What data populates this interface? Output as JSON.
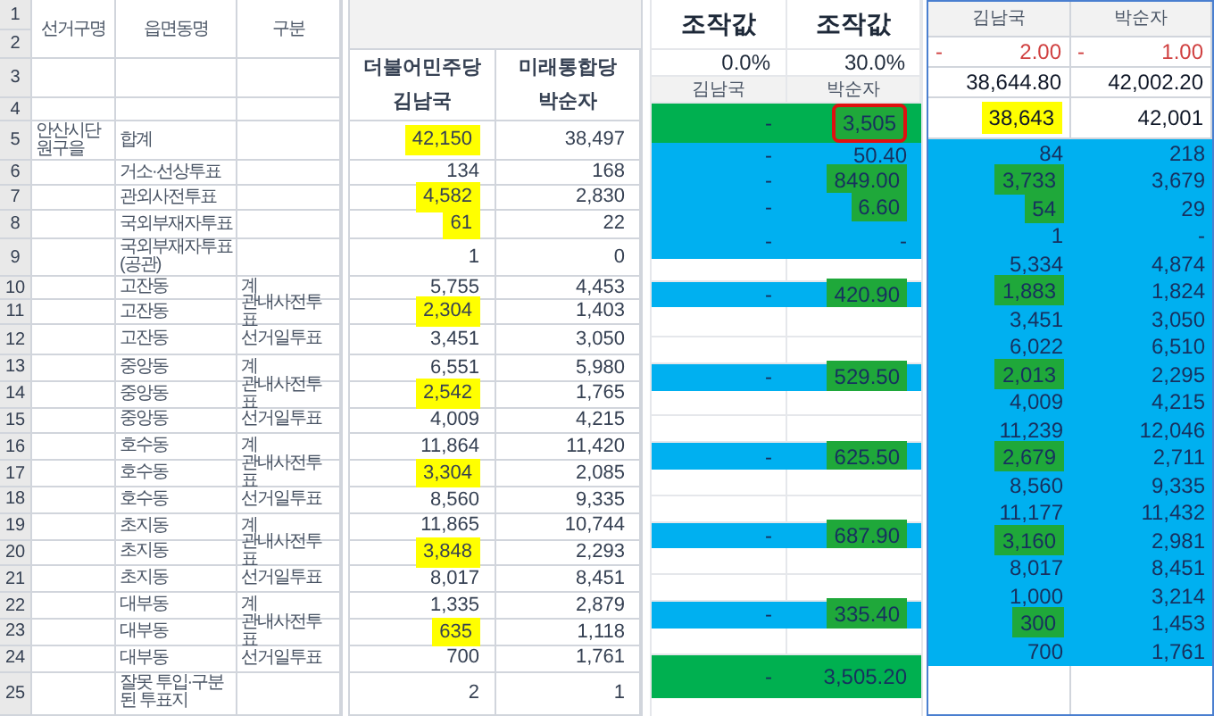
{
  "sheet_a": {
    "row_numbers": [
      "1",
      "2",
      "3",
      "4",
      "5",
      "6",
      "7",
      "8",
      "9",
      "10",
      "11",
      "12",
      "13",
      "14",
      "15",
      "16",
      "17",
      "18",
      "19",
      "20",
      "21",
      "22",
      "23",
      "24",
      "25"
    ],
    "columns": [
      "선거구명",
      "읍면동명",
      "구분"
    ],
    "rows": [
      {
        "district": "안산시단원구을",
        "dong": "합계"
      },
      {
        "dong": "거소·선상투표"
      },
      {
        "dong": "관외사전투표"
      },
      {
        "dong": "국외부재자투표"
      },
      {
        "dong": "국외부재자투표(공관)"
      },
      {
        "dong": "고잔동",
        "type": "계"
      },
      {
        "dong": "고잔동",
        "type": "관내사전투표"
      },
      {
        "dong": "고잔동",
        "type": "선거일투표"
      },
      {
        "dong": "중앙동",
        "type": "계"
      },
      {
        "dong": "중앙동",
        "type": "관내사전투표"
      },
      {
        "dong": "중앙동",
        "type": "선거일투표"
      },
      {
        "dong": "호수동",
        "type": "계"
      },
      {
        "dong": "호수동",
        "type": "관내사전투표"
      },
      {
        "dong": "호수동",
        "type": "선거일투표"
      },
      {
        "dong": "초지동",
        "type": "계"
      },
      {
        "dong": "초지동",
        "type": "관내사전투표"
      },
      {
        "dong": "초지동",
        "type": "선거일투표"
      },
      {
        "dong": "대부동",
        "type": "계"
      },
      {
        "dong": "대부동",
        "type": "관내사전투표"
      },
      {
        "dong": "대부동",
        "type": "선거일투표"
      },
      {
        "dong": "잘못 투입·구분된 투표지"
      }
    ]
  },
  "sheet_b": {
    "columns": [
      {
        "party": "더불어민주당",
        "candidate": "김남국"
      },
      {
        "party": "미래통합당",
        "candidate": "박순자"
      }
    ],
    "rows": [
      [
        {
          "text": "42,150",
          "highlighted": true,
          "color": "#ffff00"
        },
        {
          "text": "38,497",
          "highlighted": false
        }
      ],
      [
        {
          "text": "134",
          "highlighted": false
        },
        {
          "text": "168",
          "highlighted": false
        }
      ],
      [
        {
          "text": "4,582",
          "highlighted": true,
          "color": "#ffff00"
        },
        {
          "text": "2,830",
          "highlighted": false
        }
      ],
      [
        {
          "text": "61",
          "highlighted": true,
          "color": "#ffff00"
        },
        {
          "text": "22",
          "highlighted": false
        }
      ],
      [
        {
          "text": "1",
          "highlighted": false
        },
        {
          "text": "0",
          "highlighted": false
        }
      ],
      [
        {
          "text": "5,755",
          "highlighted": false
        },
        {
          "text": "4,453",
          "highlighted": false
        }
      ],
      [
        {
          "text": "2,304",
          "highlighted": true,
          "color": "#ffff00"
        },
        {
          "text": "1,403",
          "highlighted": false
        }
      ],
      [
        {
          "text": "3,451",
          "highlighted": false
        },
        {
          "text": "3,050",
          "highlighted": false
        }
      ],
      [
        {
          "text": "6,551",
          "highlighted": false
        },
        {
          "text": "5,980",
          "highlighted": false
        }
      ],
      [
        {
          "text": "2,542",
          "highlighted": true,
          "color": "#ffff00"
        },
        {
          "text": "1,765",
          "highlighted": false
        }
      ],
      [
        {
          "text": "4,009",
          "highlighted": false
        },
        {
          "text": "4,215",
          "highlighted": false
        }
      ],
      [
        {
          "text": "11,864",
          "highlighted": false
        },
        {
          "text": "11,420",
          "highlighted": false
        }
      ],
      [
        {
          "text": "3,304",
          "highlighted": true,
          "color": "#ffff00"
        },
        {
          "text": "2,085",
          "highlighted": false
        }
      ],
      [
        {
          "text": "8,560",
          "highlighted": false
        },
        {
          "text": "9,335",
          "highlighted": false
        }
      ],
      [
        {
          "text": "11,865",
          "highlighted": false
        },
        {
          "text": "10,744",
          "highlighted": false
        }
      ],
      [
        {
          "text": "3,848",
          "highlighted": true,
          "color": "#ffff00"
        },
        {
          "text": "2,293",
          "highlighted": false
        }
      ],
      [
        {
          "text": "8,017",
          "highlighted": false
        },
        {
          "text": "8,451",
          "highlighted": false
        }
      ],
      [
        {
          "text": "1,335",
          "highlighted": false
        },
        {
          "text": "2,879",
          "highlighted": false
        }
      ],
      [
        {
          "text": "635",
          "highlighted": true,
          "color": "#ffff00"
        },
        {
          "text": "1,118",
          "highlighted": false
        }
      ],
      [
        {
          "text": "700",
          "highlighted": false
        },
        {
          "text": "1,761",
          "highlighted": false
        }
      ],
      [
        {
          "text": "2",
          "highlighted": false
        },
        {
          "text": "1",
          "highlighted": false
        }
      ]
    ]
  },
  "sheet_c": {
    "headers": [
      "조작값",
      "조작값"
    ],
    "rates": [
      "0.0%",
      "30.0%"
    ],
    "candidates": [
      "김남국",
      "박순자"
    ],
    "rows": [
      {
        "color": "#00b050",
        "cells": [
          {
            "text": "-",
            "highlighted": false,
            "circled": false
          },
          {
            "text": "3,505",
            "highlighted": true,
            "color": "#1fa83a",
            "circled": true
          }
        ]
      },
      {
        "color": "#00b0f0",
        "cells": [
          {
            "text": "-",
            "highlighted": false,
            "circled": false
          },
          {
            "text": "50.40",
            "highlighted": false,
            "circled": false
          }
        ]
      },
      {
        "color": "#00b0f0",
        "cells": [
          {
            "text": "-",
            "highlighted": false,
            "circled": false
          },
          {
            "text": "849.00",
            "highlighted": true,
            "color": "#1fa83a",
            "circled": false
          }
        ]
      },
      {
        "color": "#00b0f0",
        "cells": [
          {
            "text": "-",
            "highlighted": false,
            "circled": false
          },
          {
            "text": "6.60",
            "highlighted": true,
            "color": "#1fa83a",
            "circled": false
          }
        ]
      },
      {
        "color": "#00b0f0",
        "cells": [
          {
            "text": "-",
            "highlighted": false,
            "circled": false
          },
          {
            "text": "-",
            "highlighted": false,
            "circled": false
          }
        ]
      },
      {
        "color": "#ffffff"
      },
      {
        "color": "#00b0f0",
        "cells": [
          {
            "text": "-",
            "highlighted": false,
            "circled": false
          },
          {
            "text": "420.90",
            "highlighted": true,
            "color": "#1fa83a",
            "circled": false
          }
        ]
      },
      {
        "color": "#ffffff"
      },
      {
        "color": "#ffffff"
      },
      {
        "color": "#00b0f0",
        "cells": [
          {
            "text": "-",
            "highlighted": false,
            "circled": false
          },
          {
            "text": "529.50",
            "highlighted": true,
            "color": "#1fa83a",
            "circled": false
          }
        ]
      },
      {
        "color": "#ffffff"
      },
      {
        "color": "#ffffff"
      },
      {
        "color": "#00b0f0",
        "cells": [
          {
            "text": "-",
            "highlighted": false,
            "circled": false
          },
          {
            "text": "625.50",
            "highlighted": true,
            "color": "#1fa83a",
            "circled": false
          }
        ]
      },
      {
        "color": "#ffffff"
      },
      {
        "color": "#ffffff"
      },
      {
        "color": "#00b0f0",
        "cells": [
          {
            "text": "-",
            "highlighted": false,
            "circled": false
          },
          {
            "text": "687.90",
            "highlighted": true,
            "color": "#1fa83a",
            "circled": false
          }
        ]
      },
      {
        "color": "#ffffff"
      },
      {
        "color": "#ffffff"
      },
      {
        "color": "#00b0f0",
        "cells": [
          {
            "text": "-",
            "highlighted": false,
            "circled": false
          },
          {
            "text": "335.40",
            "highlighted": true,
            "color": "#1fa83a",
            "circled": false
          }
        ]
      },
      {
        "color": "#ffffff"
      },
      {
        "color": "#00b050",
        "cells": [
          {
            "text": "-",
            "highlighted": false,
            "circled": false
          },
          {
            "text": "3,505.20",
            "highlighted": false,
            "circled": false
          }
        ]
      }
    ]
  },
  "sheet_d": {
    "columns": [
      "김남국",
      "박순자"
    ],
    "rows": [
      {
        "kind": "adjustment",
        "color": "#ffffff",
        "cells": [
          {
            "sign": "-",
            "text": "2.00",
            "highlighted": false
          },
          {
            "sign": "-",
            "text": "1.00",
            "highlighted": false
          }
        ]
      },
      {
        "kind": "number",
        "color": "#ffffff",
        "cells": [
          {
            "text": "38,644.80",
            "highlighted": false
          },
          {
            "text": "42,002.20",
            "highlighted": false
          }
        ]
      },
      {
        "kind": "number",
        "color": "#ffffff",
        "cells": [
          {
            "text": "38,643",
            "highlighted": true,
            "color": "#ffff00"
          },
          {
            "text": "42,001",
            "highlighted": false
          }
        ]
      },
      {
        "kind": "number",
        "color": "#00b0f0",
        "cells": [
          {
            "text": "84",
            "highlighted": false
          },
          {
            "text": "218",
            "highlighted": false
          }
        ]
      },
      {
        "kind": "number",
        "color": "#00b0f0",
        "cells": [
          {
            "text": "3,733",
            "highlighted": true,
            "color": "#1fa83a"
          },
          {
            "text": "3,679",
            "highlighted": false
          }
        ]
      },
      {
        "kind": "number",
        "color": "#00b0f0",
        "cells": [
          {
            "text": "54",
            "highlighted": true,
            "color": "#1fa83a"
          },
          {
            "text": "29",
            "highlighted": false
          }
        ]
      },
      {
        "kind": "number",
        "color": "#00b0f0",
        "cells": [
          {
            "text": "1",
            "highlighted": false
          },
          {
            "text": "-",
            "highlighted": false
          }
        ]
      },
      {
        "kind": "number",
        "color": "#00b0f0",
        "cells": [
          {
            "text": "5,334",
            "highlighted": false
          },
          {
            "text": "4,874",
            "highlighted": false
          }
        ]
      },
      {
        "kind": "number",
        "color": "#00b0f0",
        "cells": [
          {
            "text": "1,883",
            "highlighted": true,
            "color": "#1fa83a"
          },
          {
            "text": "1,824",
            "highlighted": false
          }
        ]
      },
      {
        "kind": "number",
        "color": "#00b0f0",
        "cells": [
          {
            "text": "3,451",
            "highlighted": false
          },
          {
            "text": "3,050",
            "highlighted": false
          }
        ]
      },
      {
        "kind": "number",
        "color": "#00b0f0",
        "cells": [
          {
            "text": "6,022",
            "highlighted": false
          },
          {
            "text": "6,510",
            "highlighted": false
          }
        ]
      },
      {
        "kind": "number",
        "color": "#00b0f0",
        "cells": [
          {
            "text": "2,013",
            "highlighted": true,
            "color": "#1fa83a"
          },
          {
            "text": "2,295",
            "highlighted": false
          }
        ]
      },
      {
        "kind": "number",
        "color": "#00b0f0",
        "cells": [
          {
            "text": "4,009",
            "highlighted": false
          },
          {
            "text": "4,215",
            "highlighted": false
          }
        ]
      },
      {
        "kind": "number",
        "color": "#00b0f0",
        "cells": [
          {
            "text": "11,239",
            "highlighted": false
          },
          {
            "text": "12,046",
            "highlighted": false
          }
        ]
      },
      {
        "kind": "number",
        "color": "#00b0f0",
        "cells": [
          {
            "text": "2,679",
            "highlighted": true,
            "color": "#1fa83a"
          },
          {
            "text": "2,711",
            "highlighted": false
          }
        ]
      },
      {
        "kind": "number",
        "color": "#00b0f0",
        "cells": [
          {
            "text": "8,560",
            "highlighted": false
          },
          {
            "text": "9,335",
            "highlighted": false
          }
        ]
      },
      {
        "kind": "number",
        "color": "#00b0f0",
        "cells": [
          {
            "text": "11,177",
            "highlighted": false
          },
          {
            "text": "11,432",
            "highlighted": false
          }
        ]
      },
      {
        "kind": "number",
        "color": "#00b0f0",
        "cells": [
          {
            "text": "3,160",
            "highlighted": true,
            "color": "#1fa83a"
          },
          {
            "text": "2,981",
            "highlighted": false
          }
        ]
      },
      {
        "kind": "number",
        "color": "#00b0f0",
        "cells": [
          {
            "text": "8,017",
            "highlighted": false
          },
          {
            "text": "8,451",
            "highlighted": false
          }
        ]
      },
      {
        "kind": "number",
        "color": "#00b0f0",
        "cells": [
          {
            "text": "1,000",
            "highlighted": false
          },
          {
            "text": "3,214",
            "highlighted": false
          }
        ]
      },
      {
        "kind": "number",
        "color": "#00b0f0",
        "cells": [
          {
            "text": "300",
            "highlighted": true,
            "color": "#1fa83a"
          },
          {
            "text": "1,453",
            "highlighted": false
          }
        ]
      },
      {
        "kind": "number",
        "color": "#00b0f0",
        "cells": [
          {
            "text": "700",
            "highlighted": false
          },
          {
            "text": "1,761",
            "highlighted": false
          }
        ]
      }
    ]
  }
}
